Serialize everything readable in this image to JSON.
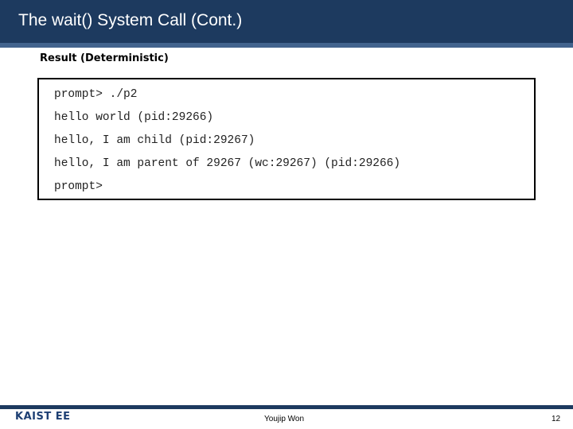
{
  "slide": {
    "title": "The wait() System Call (Cont.)",
    "section_heading": "Result (Deterministic)",
    "terminal": {
      "lines": [
        "prompt> ./p2",
        "hello world (pid:29266)",
        "hello, I am child (pid:29267)",
        "hello, I am parent of 29267 (wc:29267) (pid:29266)",
        "prompt>"
      ]
    }
  },
  "footer": {
    "logo": "KAIST EE",
    "author": "Youjip Won",
    "page_number": "12"
  },
  "colors": {
    "header_bg": "#1d3a5f",
    "header_stripe": "#42638d",
    "logo": "#1d3f73"
  }
}
